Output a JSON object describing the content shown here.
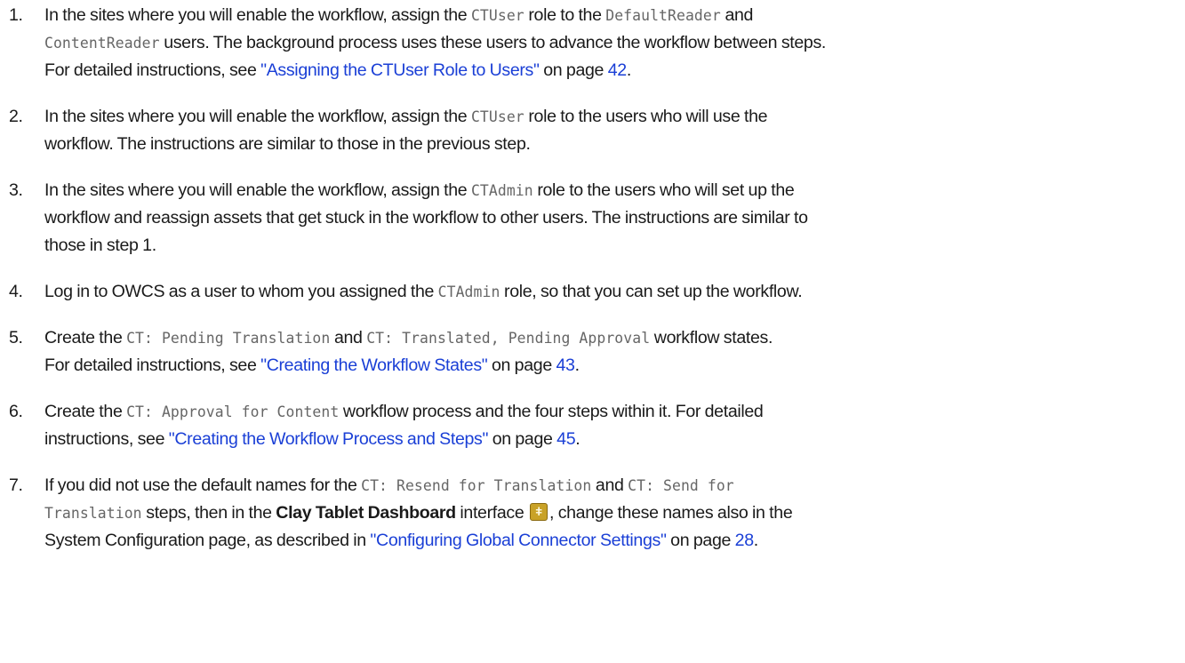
{
  "steps": [
    {
      "num": "1.",
      "l1": {
        "t1": "In the sites where you will enable the workflow, assign the ",
        "c1": "CTUser",
        "t2": " role to the ",
        "c2": "DefaultReader",
        "t3": " and"
      },
      "l2": {
        "c1": "ContentReader",
        "t1": " users. The background process uses these users to advance the workflow between steps."
      },
      "l3": {
        "t1": "For detailed instructions, see ",
        "link": "\"Assigning the CTUser Role to Users\"",
        "t2": " on page ",
        "page": "42",
        "t3": "."
      }
    },
    {
      "num": "2.",
      "l1": {
        "t1": "In the sites where you will enable the workflow, assign the ",
        "c1": "CTUser",
        "t2": " role to the users who will use the"
      },
      "l2": {
        "t1": "workflow. The instructions are similar to those in the previous step."
      }
    },
    {
      "num": "3.",
      "l1": {
        "t1": "In the sites where you will enable the workflow, assign the ",
        "c1": "CTAdmin",
        "t2": " role to the users who will set up the"
      },
      "l2": {
        "t1": "workflow and reassign assets that get stuck in the workflow to other users. The instructions are similar to"
      },
      "l3": {
        "t1": "those in step 1."
      }
    },
    {
      "num": "4.",
      "l1": {
        "t1": "Log in to OWCS as a user to whom you assigned the ",
        "c1": "CTAdmin",
        "t2": " role, so that you can set up the workflow."
      }
    },
    {
      "num": "5.",
      "l1": {
        "t1": "Create the ",
        "c1": "CT: Pending Translation",
        "t2": " and ",
        "c2": "CT: Translated, Pending Approval",
        "t3": " workflow states."
      },
      "l2": {
        "t1": "For detailed instructions, see ",
        "link": "\"Creating the Workflow States\"",
        "t2": " on page ",
        "page": "43",
        "t3": "."
      }
    },
    {
      "num": "6.",
      "l1": {
        "t1": "Create the ",
        "c1": "CT: Approval for Content",
        "t2": " workflow process and the four steps within it. For detailed"
      },
      "l2": {
        "t1": "instructions, see ",
        "link": "\"Creating the Workflow Process and Steps\"",
        "t2": " on page ",
        "page": "45",
        "t3": "."
      }
    },
    {
      "num": "7.",
      "l1": {
        "t1": "If you did not use the default names for the ",
        "c1": "CT: Resend for Translation",
        "t2": " and ",
        "c2": "CT: Send for"
      },
      "l2": {
        "c1": "Translation",
        "t1": " steps, then in the ",
        "b1": "Clay Tablet Dashboard",
        "t2": " interface ",
        "t3": ", change these names also in the"
      },
      "l3": {
        "t1": "System Configuration page, as described in ",
        "link": "\"Configuring Global Connector Settings\"",
        "t2": " on page ",
        "page": "28",
        "t3": "."
      }
    }
  ],
  "icons": {
    "dashboard": "clay-tablet-dashboard-icon",
    "dashboard_color": "#c9a227"
  },
  "colors": {
    "text": "#1a1a1a",
    "code": "#666666",
    "link": "#1a3fd6"
  }
}
